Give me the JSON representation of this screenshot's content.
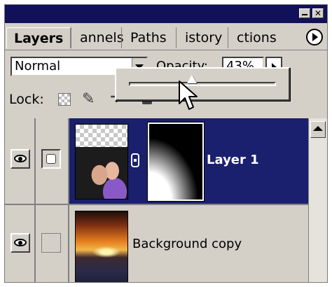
{
  "panel": {
    "tabs": [
      {
        "label": "Layers",
        "active": true
      },
      {
        "label": "Channels",
        "visible_text": "annels"
      },
      {
        "label": "Paths",
        "visible_text": "Paths"
      },
      {
        "label": "History",
        "visible_text": "istory"
      },
      {
        "label": "Actions",
        "visible_text": "ctions"
      }
    ],
    "blend_mode": "Normal",
    "opacity_label": "Opacity:",
    "opacity_value": "43%",
    "opacity_fraction": 0.43,
    "lock_label": "Lock:",
    "layers": [
      {
        "name": "Layer 1",
        "selected": true,
        "visible": true,
        "has_mask": true
      },
      {
        "name": "Background copy",
        "selected": false,
        "visible": true,
        "has_mask": false
      }
    ]
  },
  "colors": {
    "title_bar": "#11115a",
    "selection": "#1a1f6e",
    "panel_bg": "#d4d0c8"
  },
  "icons": [
    "minimize-icon",
    "close-icon",
    "panel-menu-icon",
    "dropdown-arrow-icon",
    "slider-arrow-icon",
    "lock-transparency-icon",
    "lock-paint-icon",
    "lock-move-icon",
    "lock-all-icon",
    "eye-icon",
    "layer-mask-icon",
    "link-icon",
    "scroll-up-icon",
    "mouse-cursor-icon"
  ]
}
